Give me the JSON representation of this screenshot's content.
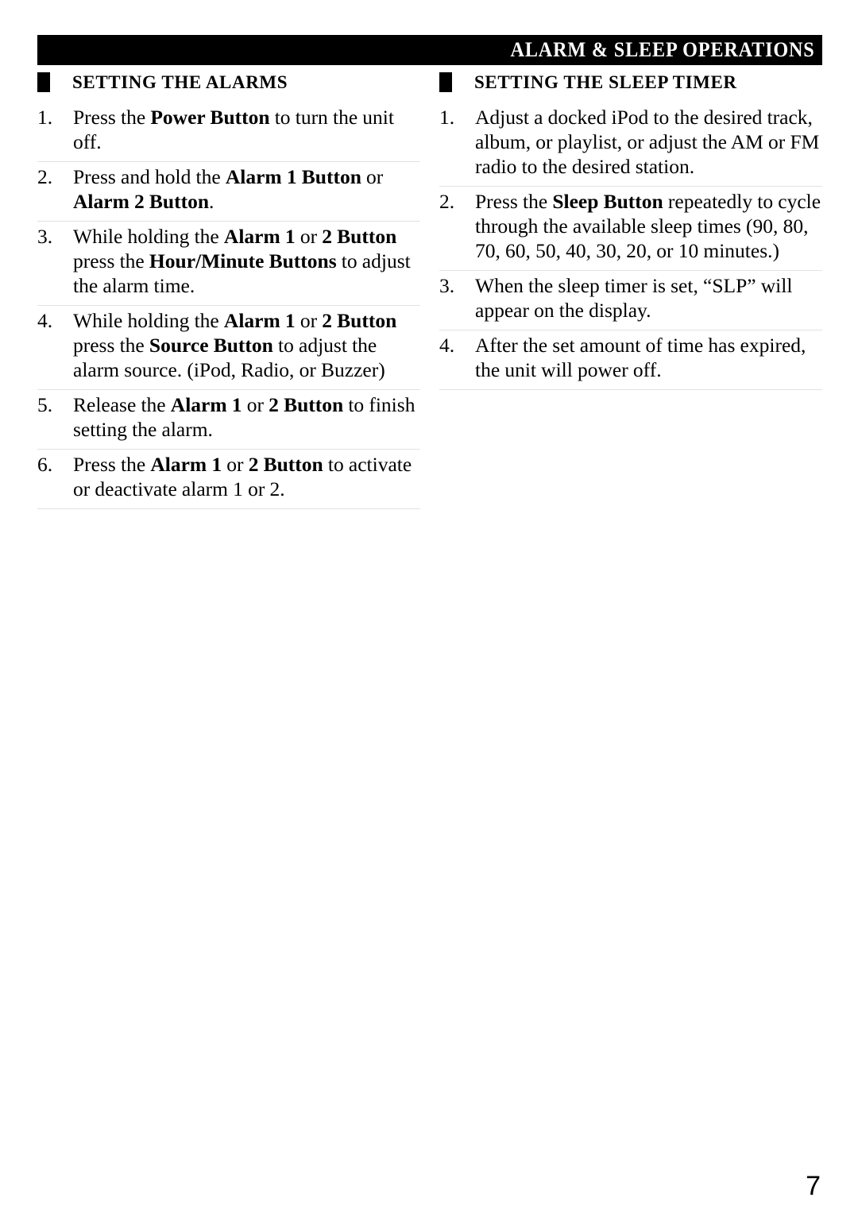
{
  "header": {
    "title": "ALARM & SLEEP OPERATIONS"
  },
  "sections": [
    {
      "id": "setting-the-alarms",
      "heading": "SETTING THE ALARMS",
      "steps": [
        {
          "number": "1.",
          "parts": [
            {
              "text": "Press the ",
              "bold": false
            },
            {
              "text": "Power Button",
              "bold": true
            },
            {
              "text": " to turn the unit off.",
              "bold": false
            }
          ]
        },
        {
          "number": "2.",
          "parts": [
            {
              "text": "Press and hold the ",
              "bold": false
            },
            {
              "text": "Alarm 1 Button",
              "bold": true
            },
            {
              "text": " or ",
              "bold": false
            },
            {
              "text": "Alarm 2 Button",
              "bold": true
            },
            {
              "text": ".",
              "bold": false
            }
          ]
        },
        {
          "number": "3.",
          "parts": [
            {
              "text": "While holding the ",
              "bold": false
            },
            {
              "text": "Alarm 1",
              "bold": true
            },
            {
              "text": " or ",
              "bold": false
            },
            {
              "text": "2 Button",
              "bold": true
            },
            {
              "text": " press the ",
              "bold": false
            },
            {
              "text": "Hour/Minute Buttons",
              "bold": true
            },
            {
              "text": " to adjust the alarm time.",
              "bold": false
            }
          ]
        },
        {
          "number": "4.",
          "parts": [
            {
              "text": "While holding the ",
              "bold": false
            },
            {
              "text": "Alarm 1",
              "bold": true
            },
            {
              "text": " or ",
              "bold": false
            },
            {
              "text": "2 Button",
              "bold": true
            },
            {
              "text": " press the ",
              "bold": false
            },
            {
              "text": "Source Button",
              "bold": true
            },
            {
              "text": " to adjust the alarm source. (iPod, Radio, or Buzzer)",
              "bold": false
            }
          ]
        },
        {
          "number": "5.",
          "parts": [
            {
              "text": "Release the ",
              "bold": false
            },
            {
              "text": "Alarm 1",
              "bold": true
            },
            {
              "text": " or ",
              "bold": false
            },
            {
              "text": "2 Button",
              "bold": true
            },
            {
              "text": " to finish setting the alarm.",
              "bold": false
            }
          ]
        },
        {
          "number": "6.",
          "parts": [
            {
              "text": "Press the ",
              "bold": false
            },
            {
              "text": "Alarm 1",
              "bold": true
            },
            {
              "text": " or ",
              "bold": false
            },
            {
              "text": "2 Button",
              "bold": true
            },
            {
              "text": " to activate or deactivate alarm 1 or 2.",
              "bold": false
            }
          ]
        }
      ]
    },
    {
      "id": "setting-the-sleep-timer",
      "heading": "SETTING THE SLEEP TIMER",
      "steps": [
        {
          "number": "1.",
          "parts": [
            {
              "text": "Adjust a docked iPod to the desired track, album, or playlist, or adjust the AM or FM radio to the desired station.",
              "bold": false
            }
          ]
        },
        {
          "number": "2.",
          "parts": [
            {
              "text": "Press the ",
              "bold": false
            },
            {
              "text": "Sleep Button",
              "bold": true
            },
            {
              "text": " repeatedly to cycle through the available sleep times (90, 80, 70, 60, 50, 40, 30, 20, or 10 minutes.)",
              "bold": false
            }
          ]
        },
        {
          "number": "3.",
          "parts": [
            {
              "text": "When the sleep timer is set, “SLP” will appear on the display.",
              "bold": false
            }
          ]
        },
        {
          "number": "4.",
          "parts": [
            {
              "text": "After the set amount of time has expired, the unit will power off.",
              "bold": false
            }
          ]
        }
      ]
    }
  ],
  "footer": {
    "page_number": "7"
  }
}
